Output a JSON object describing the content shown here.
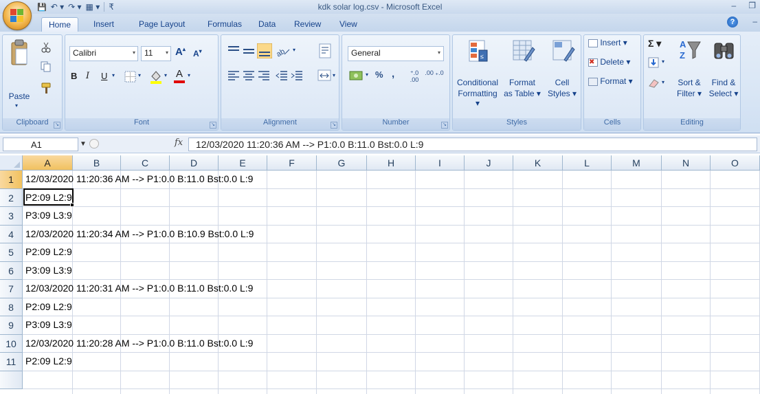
{
  "window": {
    "title": "kdk solar log.csv - Microsoft Excel",
    "minimize": "–",
    "restore": "❐"
  },
  "qat": {
    "save": "💾",
    "undo": "↶ ▾",
    "redo": "↷ ▾",
    "table": "▦ ▾",
    "customize": "₹"
  },
  "tabs": [
    "Home",
    "Insert",
    "Page Layout",
    "Formulas",
    "Data",
    "Review",
    "View"
  ],
  "ribbon": {
    "clipboard": {
      "label": "Clipboard",
      "paste": "Paste"
    },
    "font": {
      "label": "Font",
      "name": "Calibri",
      "size": "11",
      "bold": "B",
      "italic": "I",
      "underline": "U"
    },
    "alignment": {
      "label": "Alignment"
    },
    "number": {
      "label": "Number",
      "format": "General",
      "percent": "%",
      "comma": ",",
      "inc_decimal": "⁺.0 .00",
      "dec_decimal": ".00 ₊.0"
    },
    "styles": {
      "label": "Styles",
      "conditional": [
        "Conditional",
        "Formatting ▾"
      ],
      "format_table": [
        "Format",
        "as Table ▾"
      ],
      "cell_styles": [
        "Cell",
        "Styles ▾"
      ]
    },
    "cells": {
      "label": "Cells",
      "insert": "Insert ▾",
      "delete": "Delete ▾",
      "format": "Format ▾"
    },
    "editing": {
      "label": "Editing",
      "sigma": "Σ ▾",
      "sort": [
        "Sort &",
        "Filter ▾"
      ],
      "find": [
        "Find &",
        "Select ▾"
      ]
    }
  },
  "formula_bar": {
    "name_box": "A1",
    "fx": "fx",
    "value": "12/03/2020 11:20:36 AM --> P1:0.0 B:11.0 Bst:0.0 L:9"
  },
  "columns": [
    "A",
    "B",
    "C",
    "D",
    "E",
    "F",
    "G",
    "H",
    "I",
    "J",
    "K",
    "L",
    "M",
    "N",
    "O"
  ],
  "rows": [
    {
      "num": "1",
      "a": "12/03/2020 11:20:36 AM --> P1:0.0 B:11.0 Bst:0.0 L:9"
    },
    {
      "num": "2",
      "a": "P2:09 L2:9"
    },
    {
      "num": "3",
      "a": "P3:09 L3:9"
    },
    {
      "num": "4",
      "a": "12/03/2020 11:20:34 AM --> P1:0.0 B:10.9 Bst:0.0 L:9"
    },
    {
      "num": "5",
      "a": "P2:09 L2:9"
    },
    {
      "num": "6",
      "a": "P3:09 L3:9"
    },
    {
      "num": "7",
      "a": "12/03/2020 11:20:31 AM --> P1:0.0 B:11.0 Bst:0.0 L:9"
    },
    {
      "num": "8",
      "a": "P2:09 L2:9"
    },
    {
      "num": "9",
      "a": "P3:09 L3:9"
    },
    {
      "num": "10",
      "a": "12/03/2020 11:20:28 AM --> P1:0.0 B:11.0 Bst:0.0 L:9"
    },
    {
      "num": "11",
      "a": "P2:09 L2:9"
    }
  ]
}
